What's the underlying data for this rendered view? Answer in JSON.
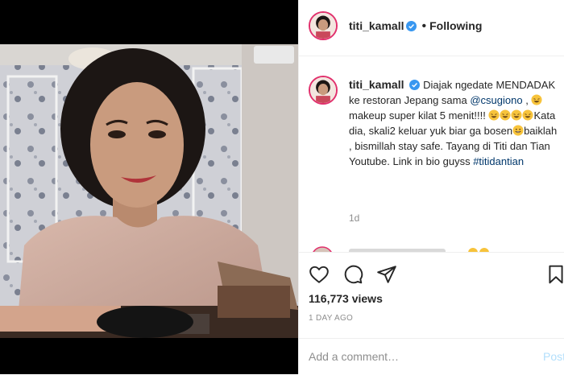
{
  "post": {
    "username": "titi_kamall",
    "follow_dot": "•",
    "follow_status": "Following",
    "caption": {
      "p1": "Diajak ngedate MENDADAK ke restoran Jepang sama",
      "mention": "@csugiono",
      "p2": ",",
      "p3": "makeup super kilat 5 menit!!!!",
      "p4": "Kata dia, skali2 keluar yuk biar ga bosen",
      "p5": "baiklah , bismillah stay safe. Tayang di Titi dan Tian Youtube. Link in bio guyss",
      "hashtag": "#titidantian"
    },
    "age": "1d",
    "views": "116,773 views",
    "timestamp": "1 DAY AGO",
    "comment_placeholder": "Add a comment…",
    "post_label": "Post"
  },
  "icons": {
    "like": "heart-icon",
    "comment": "speech-bubble-icon",
    "share": "paper-plane-icon",
    "save": "bookmark-icon",
    "verified": "verified-badge-icon"
  },
  "colors": {
    "verified": "#3897f0",
    "avatar_ring": "#e1306c",
    "link": "#00376b",
    "muted": "#8e8e8e",
    "post_disabled": "#b2dffc"
  }
}
